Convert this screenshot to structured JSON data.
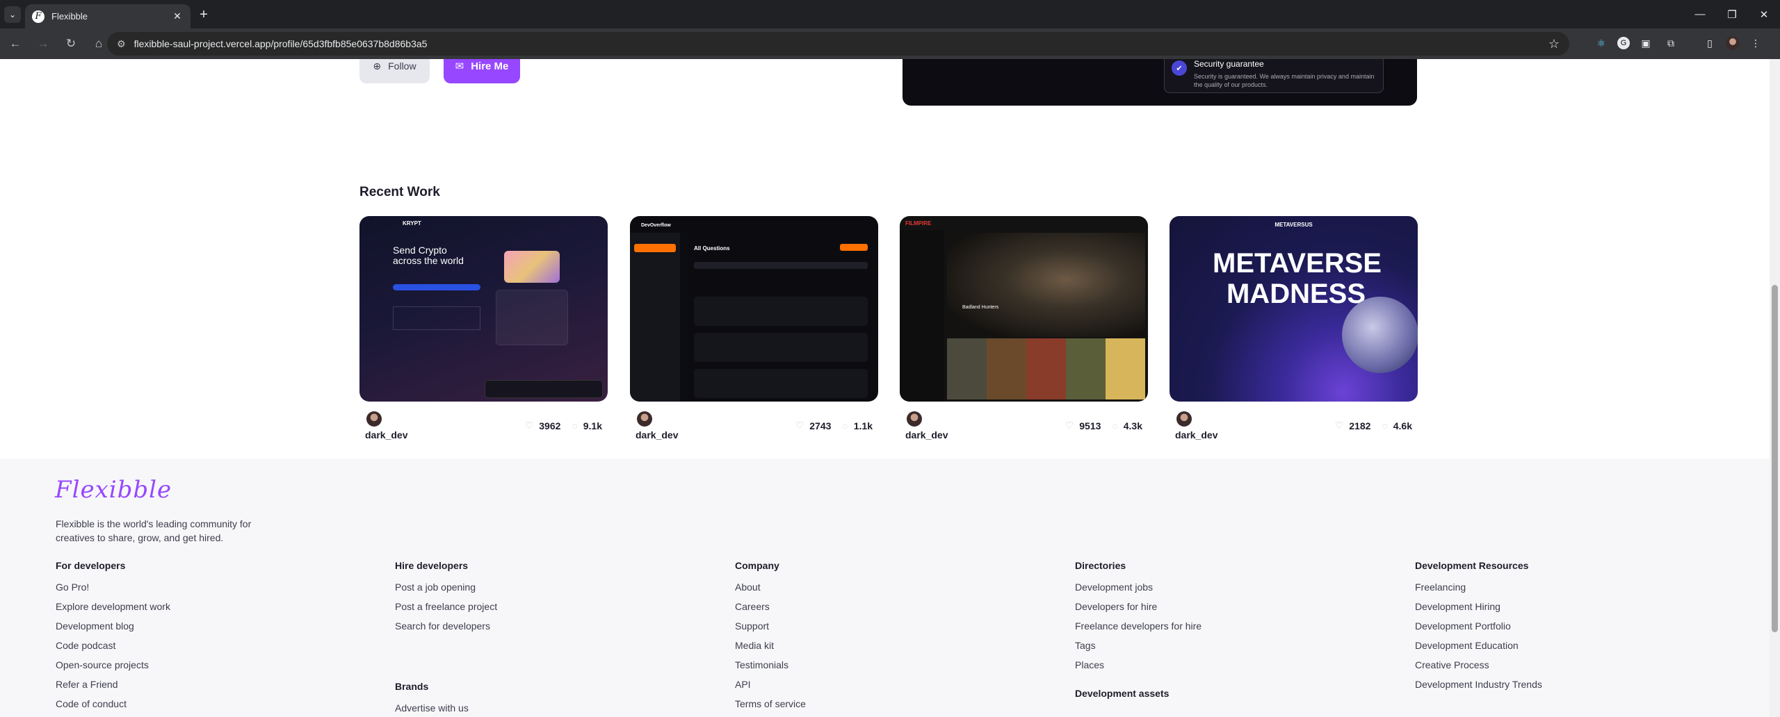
{
  "browser": {
    "tab_title": "Flexibble",
    "url": "flexibble-saul-project.vercel.app/profile/65d3fbfb85e0637b8d86b3a5"
  },
  "profile": {
    "follow_label": "Follow",
    "hire_label": "Hire Me",
    "security_title": "Security guarantee",
    "security_text": "Security is guaranteed. We always maintain privacy and maintain the quality of our products."
  },
  "recent_work": {
    "title": "Recent Work",
    "projects": [
      {
        "author": "dark_dev",
        "likes": "3962",
        "views": "9.1k",
        "heading": "Send Crypto across the world",
        "brand": "KRYPT"
      },
      {
        "author": "dark_dev",
        "likes": "2743",
        "views": "1.1k",
        "heading": "All Questions",
        "brand": "DevOverflow"
      },
      {
        "author": "dark_dev",
        "likes": "9513",
        "views": "4.3k",
        "heading": "Badland Hunters",
        "brand": "FILMPIRE"
      },
      {
        "author": "dark_dev",
        "likes": "2182",
        "views": "4.6k",
        "heading": "METAVERSE MADNESS",
        "brand": "METAVERSUS"
      }
    ]
  },
  "footer": {
    "logo": "Flexibble",
    "tagline": "Flexibble is the world's leading community for creatives to share, grow, and get hired.",
    "columns": [
      {
        "title": "For developers",
        "links": [
          "Go Pro!",
          "Explore development work",
          "Development blog",
          "Code podcast",
          "Open-source projects",
          "Refer a Friend",
          "Code of conduct"
        ]
      },
      {
        "title": "Hire developers",
        "links": [
          "Post a job opening",
          "Post a freelance project",
          "Search for developers"
        ]
      },
      {
        "title": "Company",
        "links": [
          "About",
          "Careers",
          "Support",
          "Media kit",
          "Testimonials",
          "API",
          "Terms of service"
        ]
      },
      {
        "title": "Directories",
        "links": [
          "Development jobs",
          "Developers for hire",
          "Freelance developers for hire",
          "Tags",
          "Places"
        ]
      },
      {
        "title": "Development Resources",
        "links": [
          "Freelancing",
          "Development Hiring",
          "Development Portfolio",
          "Development Education",
          "Creative Process",
          "Development Industry Trends"
        ]
      }
    ],
    "brands_title": "Brands",
    "brands_links": [
      "Advertise with us"
    ],
    "assets_title": "Development assets"
  }
}
